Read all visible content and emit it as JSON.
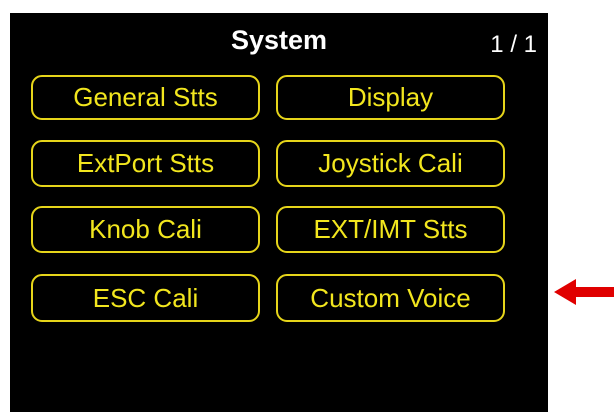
{
  "screen": {
    "title": "System",
    "page_indicator": "1 / 1"
  },
  "menu": {
    "items": [
      {
        "label": "General Stts"
      },
      {
        "label": "Display"
      },
      {
        "label": "ExtPort Stts"
      },
      {
        "label": "Joystick Cali"
      },
      {
        "label": "Knob Cali"
      },
      {
        "label": "EXT/IMT Stts"
      },
      {
        "label": "ESC Cali"
      },
      {
        "label": "Custom Voice"
      }
    ]
  },
  "colors": {
    "screen_background": "#000000",
    "button_border": "#e6d51a",
    "button_text": "#f2e61e",
    "title_text": "#ffffff",
    "pointer_arrow": "#e00000"
  },
  "annotation": {
    "pointer_icon": "left-arrow-icon"
  }
}
